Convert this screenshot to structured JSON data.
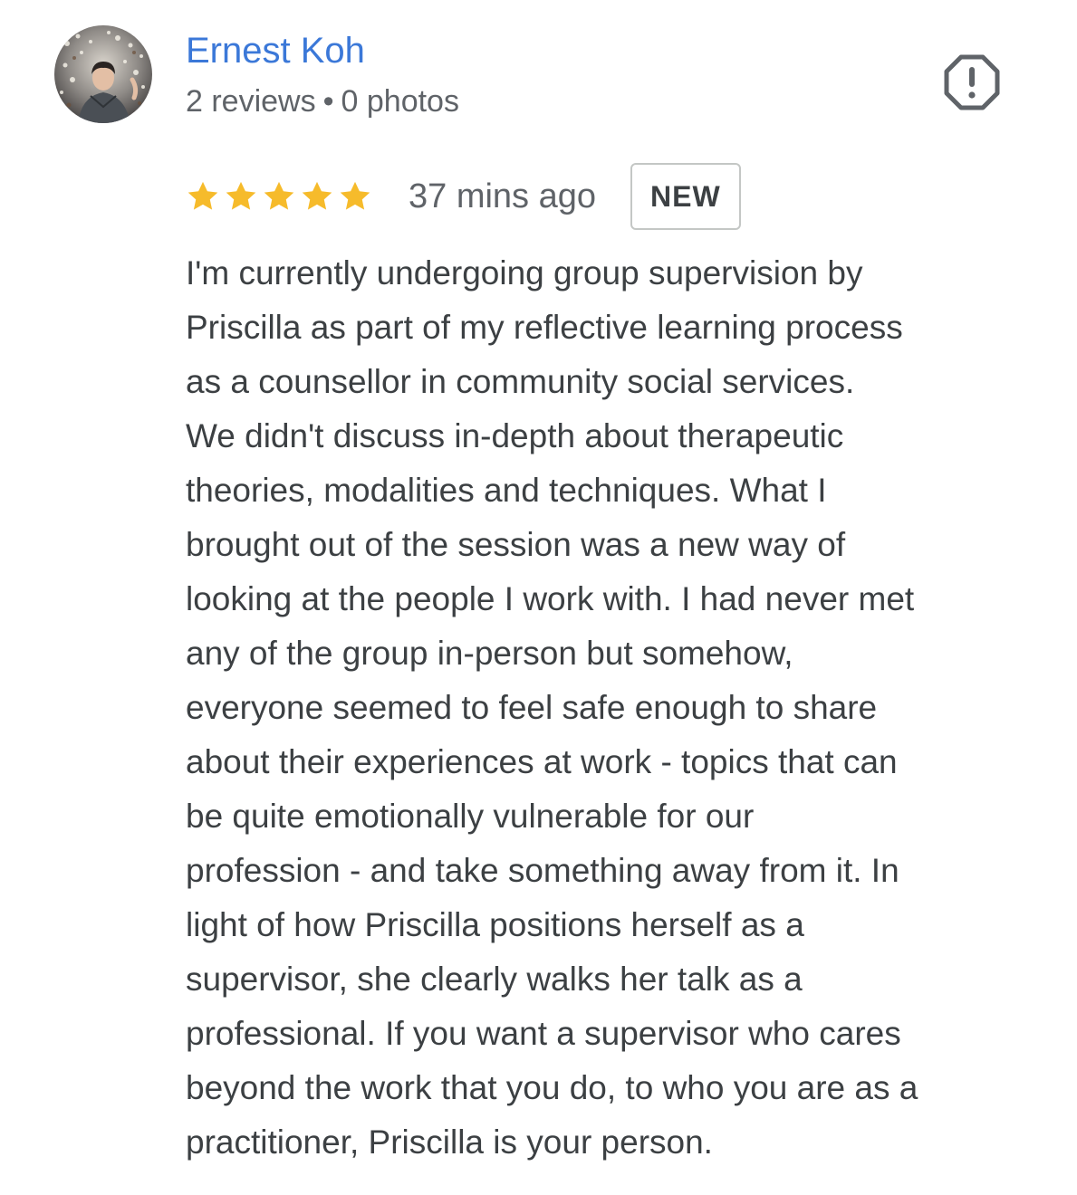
{
  "reviewer": {
    "name": "Ernest Koh",
    "reviews": "2 reviews",
    "separator": "•",
    "photos": "0 photos"
  },
  "icons": {
    "avatar": "profile-photo",
    "report": "report-flag-icon",
    "star": "star-icon"
  },
  "review": {
    "rating": 5,
    "max_rating": 5,
    "time_ago": "37 mins ago",
    "badge": "NEW",
    "lines": [
      "I'm currently undergoing group supervision by",
      "Priscilla as part of my reflective learning process",
      "as a counsellor in community social services.",
      "We didn't discuss in-depth about therapeutic",
      "theories, modalities and techniques. What I",
      "brought out of the session was a new way of",
      "looking at the people I work with. I had never met",
      "any of the group in-person but somehow,",
      "everyone seemed to feel safe enough to share",
      "about their experiences at work - topics that can",
      "be quite emotionally vulnerable for our",
      "profession - and take something away from it. In",
      "light of how Priscilla positions herself as a",
      "supervisor, she clearly walks her talk as a",
      "professional. If you want a supervisor who cares",
      "beyond the work that you do, to who you are as a",
      "practitioner, Priscilla is your person."
    ]
  },
  "colors": {
    "name_link": "#3b78d8",
    "star": "#f6bb2b",
    "meta_text": "#5f6368",
    "body_text": "#3c4043",
    "badge_border": "#c4c7c5",
    "report_icon": "#5f6368"
  }
}
